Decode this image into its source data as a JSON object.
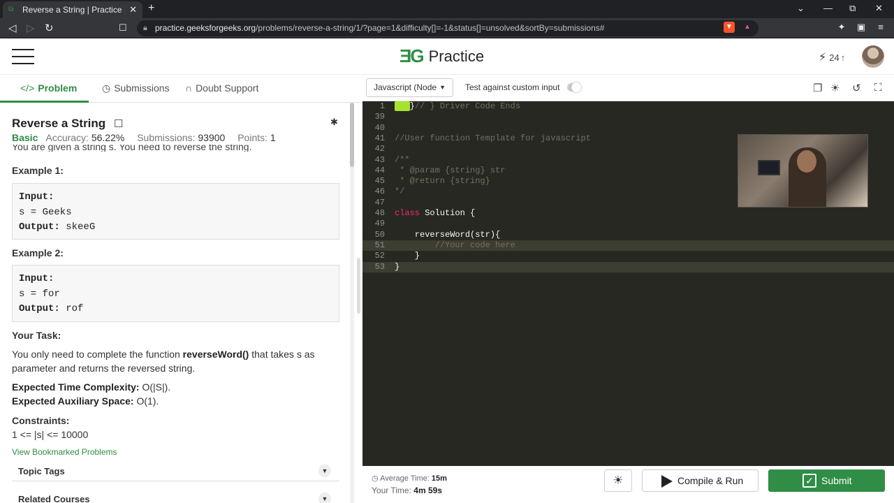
{
  "browser": {
    "tab_title": "Reverse a String | Practice | Geeks",
    "url_host": "practice.geeksforgeeks.org",
    "url_path": "/problems/reverse-a-string/1/?page=1&difficulty[]=-1&status[]=unsolved&sortBy=submissions#"
  },
  "header": {
    "logo_text": "Practice",
    "logo_mark": "ƎG",
    "streak": "24"
  },
  "left_tabs": {
    "problem": "Problem",
    "submissions": "Submissions",
    "doubt": "Doubt Support"
  },
  "problem": {
    "title": "Reverse a String",
    "difficulty": "Basic",
    "accuracy_label": "Accuracy:",
    "accuracy": "56.22%",
    "submissions_label": "Submissions:",
    "submissions": "93900",
    "points_label": "Points:",
    "points": "1",
    "intro_cut": "You are given a string s. You need to reverse the string.",
    "example1_heading": "Example 1:",
    "example1_input_label": "Input:",
    "example1_input": "s = Geeks",
    "example1_output_label": "Output:",
    "example1_output": "skeeG",
    "example2_heading": "Example 2:",
    "example2_input_label": "Input:",
    "example2_input": "s = for",
    "example2_output_label": "Output:",
    "example2_output": "rof",
    "task_heading": "Your Task:",
    "task_pre": "You only need to complete the function ",
    "task_fn": "reverseWord()",
    "task_post": " that takes s as parameter and returns the reversed string.",
    "time_label": "Expected Time Complexity:",
    "time_value": "O(|S|).",
    "space_label": "Expected Auxiliary Space:",
    "space_value": "O(1).",
    "constraints_heading": "Constraints:",
    "constraints_value": "1 <= |s| <= 10000",
    "bookmarked_link": "View Bookmarked Problems",
    "topic_tags": "Topic Tags",
    "related_courses": "Related Courses"
  },
  "editor_toolbar": {
    "language": "Javascript (Node",
    "custom_input": "Test against custom input"
  },
  "code_lines": [
    {
      "n": "1",
      "parts": [
        {
          "t": "fold",
          "s": "..."
        },
        {
          "t": "txt",
          "s": "}"
        },
        {
          "t": "cm",
          "s": "// } Driver Code Ends"
        }
      ]
    },
    {
      "n": "39",
      "parts": []
    },
    {
      "n": "40",
      "parts": []
    },
    {
      "n": "41",
      "parts": [
        {
          "t": "cm",
          "s": "//User function Template for javascript"
        }
      ]
    },
    {
      "n": "42",
      "parts": []
    },
    {
      "n": "43",
      "parts": [
        {
          "t": "cm",
          "s": "/**"
        }
      ]
    },
    {
      "n": "44",
      "parts": [
        {
          "t": "cm",
          "s": " * @param {string} str"
        }
      ]
    },
    {
      "n": "45",
      "parts": [
        {
          "t": "cm",
          "s": " * @return {string}"
        }
      ]
    },
    {
      "n": "46",
      "parts": [
        {
          "t": "cm",
          "s": "*/"
        }
      ]
    },
    {
      "n": "47",
      "parts": []
    },
    {
      "n": "48",
      "parts": [
        {
          "t": "kw",
          "s": "class "
        },
        {
          "t": "txt",
          "s": "Solution {"
        }
      ]
    },
    {
      "n": "49",
      "parts": []
    },
    {
      "n": "50",
      "parts": [
        {
          "t": "txt",
          "s": "    reverseWord(str){"
        }
      ]
    },
    {
      "n": "51",
      "parts": [
        {
          "t": "cm",
          "s": "        //Your code here"
        }
      ],
      "hl": true
    },
    {
      "n": "52",
      "parts": [
        {
          "t": "txt",
          "s": "    }"
        }
      ]
    },
    {
      "n": "53",
      "parts": [
        {
          "t": "txt",
          "s": "}"
        }
      ],
      "hl": true
    }
  ],
  "footer": {
    "avg_label": "Average Time:",
    "avg_value": "15m",
    "your_label": "Your Time:",
    "your_value": "4m 59s",
    "run_label": "Compile & Run",
    "submit_label": "Submit"
  },
  "colors": {
    "brand_green": "#2f8d46",
    "editor_bg": "#272822"
  }
}
